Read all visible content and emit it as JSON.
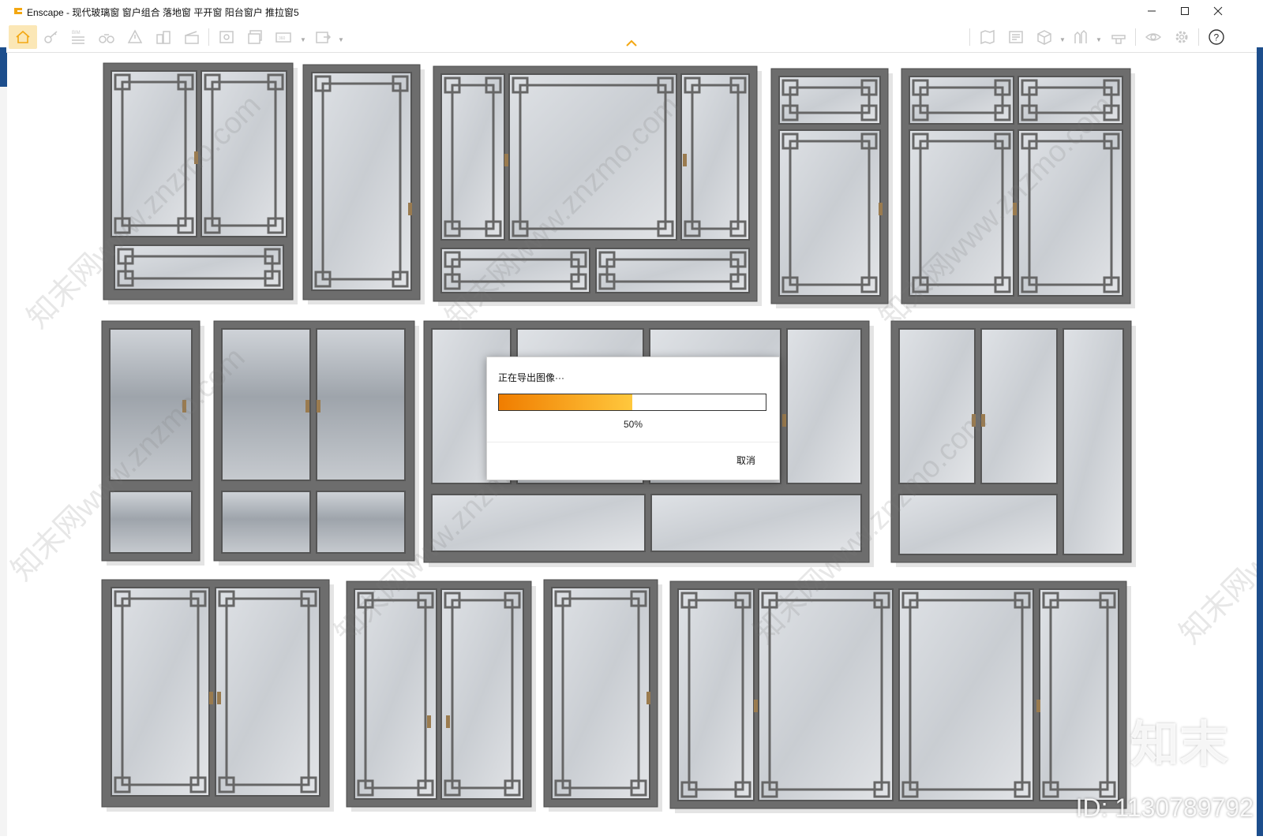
{
  "window": {
    "title": "Enscape - 现代玻璃窗 窗户组合 落地窗 平开窗 阳台窗户 推拉窗5",
    "controls": [
      "minimize",
      "maximize",
      "close"
    ]
  },
  "toolbar": {
    "left_icons": [
      "home-icon",
      "key-icon",
      "bim-icon",
      "binoculars-icon",
      "alert-icon",
      "buildings-icon",
      "clapper-icon",
      "screenshot-icon",
      "batch-render-icon",
      "panorama-icon",
      "export-icon"
    ],
    "right_icons": [
      "map-icon",
      "atlas-icon",
      "cube-icon",
      "asset-library-icon",
      "material-icon",
      "visibility-icon",
      "settings-icon",
      "help-icon"
    ],
    "accent": "#f3a712"
  },
  "dialog": {
    "title": "正在导出图像···",
    "progress": 0.5,
    "percent_label": "50%",
    "cancel_label": "取消",
    "bar_start_color": "#f07d00",
    "bar_end_color": "#ffc83d"
  },
  "watermark": {
    "site": "知末网www.znzmo.com",
    "brand": "知末",
    "id_label": "ID: 1130789792"
  }
}
